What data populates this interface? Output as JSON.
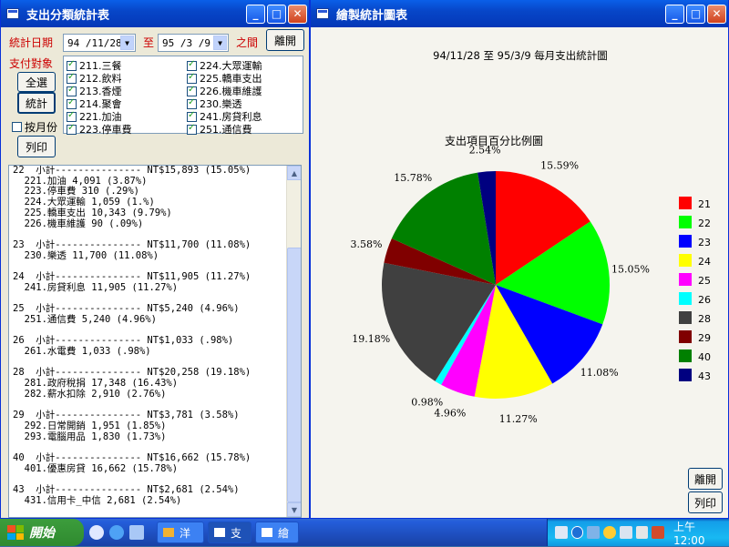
{
  "left_window": {
    "title": "支出分類統計表",
    "date_label": "統計日期",
    "date_from": "94 /11/28",
    "to_label": "至",
    "date_to": "95 /3 /9",
    "between_label": "之間",
    "leave_button": "離開",
    "target_label": "支付對象",
    "select_all_button": "全選",
    "stats_button": "統計",
    "by_month_label": "按月份",
    "print_button": "列印",
    "categories": [
      "211.三餐",
      "224.大眾運輸",
      "212.飲料",
      "225.轎車支出",
      "213.香煙",
      "226.機車維護",
      "214.聚會",
      "230.樂透",
      "221.加油",
      "241.房貸利息",
      "223.停車費",
      "251.通信費"
    ],
    "report_lines": [
      "22  小計--------------- NT$15,893 (15.05%)",
      "  221.加油 4,091 (3.87%)",
      "  223.停車費 310 (.29%)",
      "  224.大眾運輸 1,059 (1.%)",
      "  225.轎車支出 10,343 (9.79%)",
      "  226.機車維護 90 (.09%)",
      "",
      "23  小計--------------- NT$11,700 (11.08%)",
      "  230.樂透 11,700 (11.08%)",
      "",
      "24  小計--------------- NT$11,905 (11.27%)",
      "  241.房貸利息 11,905 (11.27%)",
      "",
      "25  小計--------------- NT$5,240 (4.96%)",
      "  251.通信費 5,240 (4.96%)",
      "",
      "26  小計--------------- NT$1,033 (.98%)",
      "  261.水電費 1,033 (.98%)",
      "",
      "28  小計--------------- NT$20,258 (19.18%)",
      "  281.政府稅捐 17,348 (16.43%)",
      "  282.薪水扣除 2,910 (2.76%)",
      "",
      "29  小計--------------- NT$3,781 (3.58%)",
      "  292.日常開銷 1,951 (1.85%)",
      "  293.電腦用品 1,830 (1.73%)",
      "",
      "40  小計--------------- NT$16,662 (15.78%)",
      "  401.優惠房貸 16,662 (15.78%)",
      "",
      "43  小計--------------- NT$2,681 (2.54%)",
      "  431.信用卡_中信 2,681 (2.54%)"
    ]
  },
  "right_window": {
    "title": "繪製統計圖表",
    "chart_heading": "94/11/28 至 95/3/9 每月支出統計圖",
    "leave_button": "離開",
    "print_button": "列印"
  },
  "chart_data": {
    "type": "pie",
    "title": "支出項目百分比例圖",
    "categories": [
      "21",
      "22",
      "23",
      "24",
      "25",
      "26",
      "28",
      "29",
      "40",
      "43"
    ],
    "values": [
      15.59,
      15.05,
      11.08,
      11.27,
      4.96,
      0.98,
      19.18,
      3.58,
      15.78,
      2.54
    ],
    "labels": [
      "15.59%",
      "15.05%",
      "11.08%",
      "11.27%",
      "4.96%",
      "0.98%",
      "19.18%",
      "3.58%",
      "15.78%",
      "2.54%"
    ],
    "colors": [
      "#ff0000",
      "#00ff00",
      "#0000ff",
      "#ffff00",
      "#ff00ff",
      "#00ffff",
      "#404040",
      "#800000",
      "#008000",
      "#000080"
    ],
    "legend": "right"
  },
  "taskbar": {
    "start_label": "開始",
    "tasks": [
      "洋",
      "支",
      "繪"
    ],
    "clock": "上午 12:00"
  }
}
